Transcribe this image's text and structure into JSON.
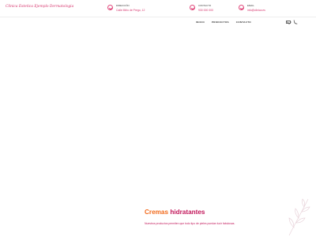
{
  "brand": {
    "name": "Clinica Estetica Ejemplo Dermatologia"
  },
  "header": {
    "info": [
      {
        "label": "Dirección",
        "value": "Calle Mirlo de Prego, 12"
      },
      {
        "label": "Contacto",
        "value": "930 000 000"
      },
      {
        "label": "Email",
        "value": "info@clinica.es"
      }
    ]
  },
  "nav": {
    "items": [
      "INICIO",
      "PRODUCTOS",
      "CONTACTO"
    ],
    "icons": [
      "mail-icon",
      "phone-icon"
    ]
  },
  "hero": {
    "title_part1": "Cremas",
    "title_part2": "hidratantes",
    "description": "Nuestros productos permiten que todo tipo de pieles puedan lucir fabulosas."
  },
  "colors": {
    "accent": "#d6336c",
    "orange": "#f26b1d",
    "deep_pink": "#c2185b"
  }
}
